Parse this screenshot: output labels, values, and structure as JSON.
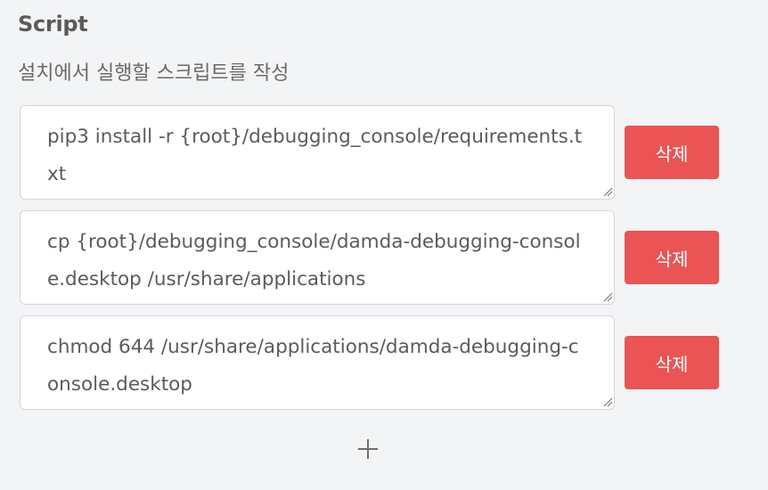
{
  "section": {
    "title": "Script",
    "description": "설치에서 실행할 스크립트를 작성"
  },
  "scripts": [
    {
      "value": "pip3 install -r {root}/debugging_console/requirements.txt",
      "delete_label": "삭제"
    },
    {
      "value": "cp {root}/debugging_console/damda-debugging-console.desktop /usr/share/applications",
      "delete_label": "삭제"
    },
    {
      "value": "chmod 644 /usr/share/applications/damda-debugging-console.desktop",
      "delete_label": "삭제"
    }
  ],
  "icons": {
    "add": "plus-icon",
    "resize": "resize-grip-icon"
  },
  "colors": {
    "background": "#f3f4f6",
    "delete_button": "#ea5455",
    "text": "#5b5b5b",
    "border": "#d4d6db"
  }
}
